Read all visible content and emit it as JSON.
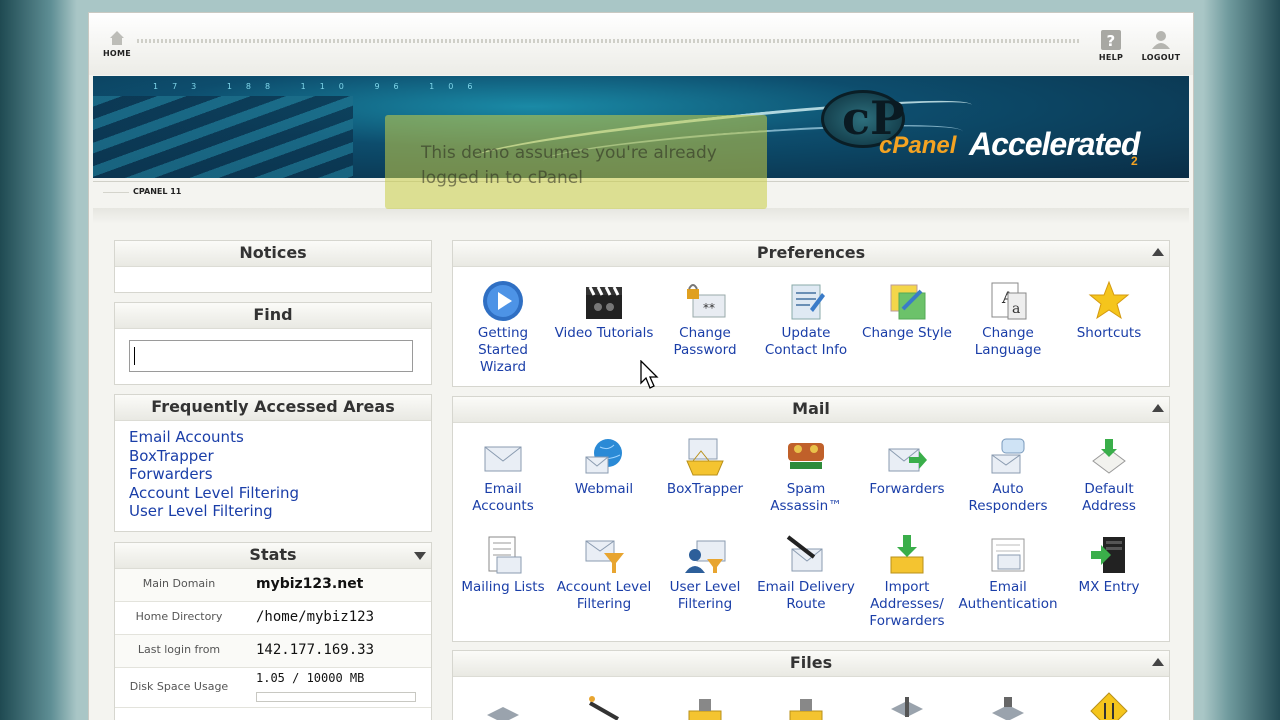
{
  "topbar": {
    "home_label": "HOME",
    "help_label": "HELP",
    "logout_label": "LOGOUT"
  },
  "banner": {
    "digits": "173 188 110 96 106",
    "logo_mark": "cP",
    "logo_text": "cPanel",
    "logo_text2": "Accelerated",
    "logo_sub": "2"
  },
  "overlay": {
    "text": "This demo assumes you're already logged in to cPanel"
  },
  "tab": {
    "label": "CPANEL 11"
  },
  "notices": {
    "title": "Notices"
  },
  "find": {
    "title": "Find",
    "value": ""
  },
  "frequent": {
    "title": "Frequently Accessed Areas",
    "links": [
      "Email Accounts",
      "BoxTrapper",
      "Forwarders",
      "Account Level Filtering",
      "User Level Filtering"
    ]
  },
  "stats": {
    "title": "Stats",
    "rows": [
      {
        "key": "Main Domain",
        "value": "mybiz123.net"
      },
      {
        "key": "Home Directory",
        "value": "/home/mybiz123"
      },
      {
        "key": "Last login from",
        "value": "142.177.169.33"
      },
      {
        "key": "Disk Space Usage",
        "value": "1.05 / 10000 MB"
      }
    ]
  },
  "preferences": {
    "title": "Preferences",
    "items": [
      {
        "label": "Getting Started Wizard",
        "icon": "play-icon"
      },
      {
        "label": "Video Tutorials",
        "icon": "clapperboard-icon"
      },
      {
        "label": "Change Password",
        "icon": "password-lock-icon"
      },
      {
        "label": "Update Contact Info",
        "icon": "contact-info-icon"
      },
      {
        "label": "Change Style",
        "icon": "style-palette-icon"
      },
      {
        "label": "Change Language",
        "icon": "language-icon"
      },
      {
        "label": "Shortcuts",
        "icon": "star-icon"
      }
    ]
  },
  "mail": {
    "title": "Mail",
    "items": [
      {
        "label": "Email Accounts",
        "icon": "envelope-icon"
      },
      {
        "label": "Webmail",
        "icon": "webmail-globe-icon"
      },
      {
        "label": "BoxTrapper",
        "icon": "boxtrapper-icon"
      },
      {
        "label": "Spam Assassin™",
        "icon": "spamassassin-icon"
      },
      {
        "label": "Forwarders",
        "icon": "forward-arrow-icon"
      },
      {
        "label": "Auto Responders",
        "icon": "autoresponder-icon"
      },
      {
        "label": "Default Address",
        "icon": "default-address-icon"
      },
      {
        "label": "Mailing Lists",
        "icon": "mailing-list-icon"
      },
      {
        "label": "Account Level Filtering",
        "icon": "account-filter-icon"
      },
      {
        "label": "User Level Filtering",
        "icon": "user-filter-icon"
      },
      {
        "label": "Email Delivery Route",
        "icon": "delivery-route-icon"
      },
      {
        "label": "Import Addresses/ Forwarders",
        "icon": "import-icon"
      },
      {
        "label": "Email Authentication",
        "icon": "email-auth-icon"
      },
      {
        "label": "MX Entry",
        "icon": "mx-server-icon"
      }
    ]
  },
  "files": {
    "title": "Files"
  },
  "colors": {
    "link": "#1a3ea8",
    "accent_orange": "#f4a322",
    "banner_dark": "#0a2d45"
  }
}
